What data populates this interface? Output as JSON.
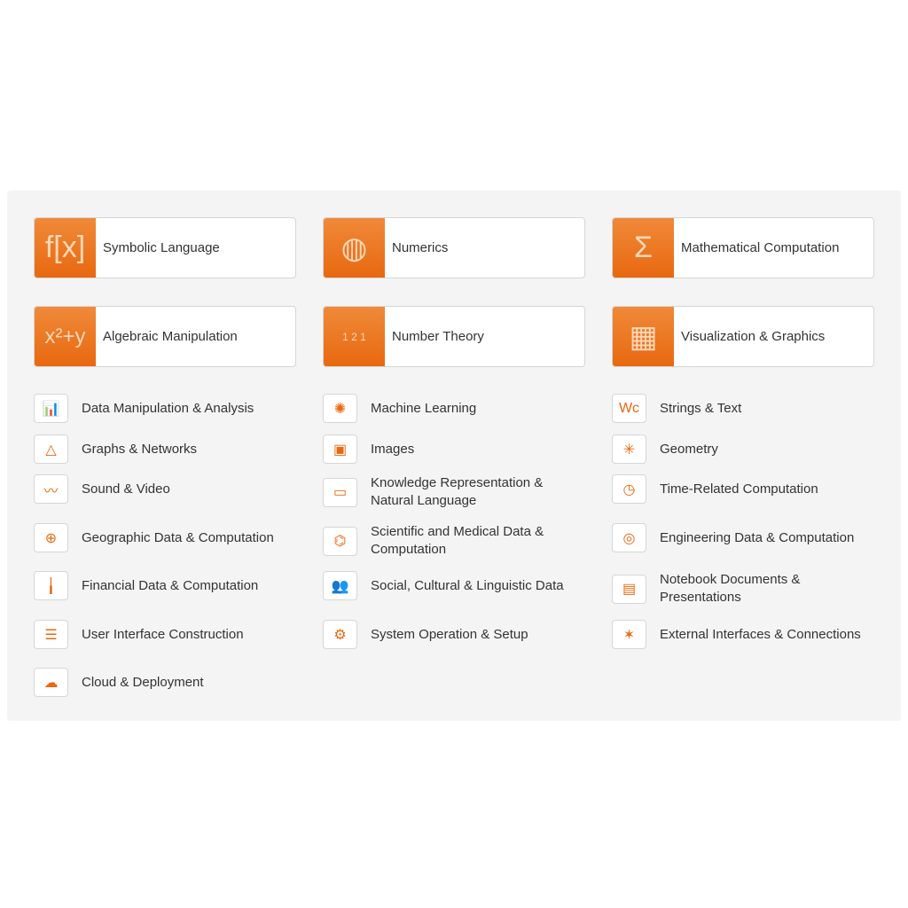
{
  "accent": "#e8680f",
  "featured": [
    {
      "label": "Symbolic Language",
      "icon": "f[x]",
      "icon_name": "fx-icon"
    },
    {
      "label": "Numerics",
      "icon": "◍",
      "icon_name": "sphere-mesh-icon"
    },
    {
      "label": "Mathematical Computation",
      "icon": "Σ",
      "icon_name": "summation-icon"
    },
    {
      "label": "Algebraic Manipulation",
      "icon": "x²+y",
      "icon_name": "algebra-icon"
    },
    {
      "label": "Number Theory",
      "icon": "1 2 1",
      "icon_name": "pascal-triangle-icon"
    },
    {
      "label": "Visualization & Graphics",
      "icon": "▦",
      "icon_name": "3d-plot-icon"
    }
  ],
  "columns": [
    [
      {
        "label": "Data Manipulation & Analysis",
        "icon": "📊",
        "icon_name": "bar-chart-icon"
      },
      {
        "label": "Graphs & Networks",
        "icon": "△",
        "icon_name": "graph-icon"
      },
      {
        "label": "Sound & Video",
        "icon": "〰",
        "icon_name": "waveform-icon"
      },
      {
        "label": "Geographic Data & Computation",
        "icon": "⊕",
        "icon_name": "globe-pin-icon"
      },
      {
        "label": "Financial Data & Computation",
        "icon": "╽",
        "icon_name": "candlestick-icon"
      },
      {
        "label": "User Interface Construction",
        "icon": "☰",
        "icon_name": "sliders-icon"
      },
      {
        "label": "Cloud & Deployment",
        "icon": "☁",
        "icon_name": "cloud-icon"
      }
    ],
    [
      {
        "label": "Machine Learning",
        "icon": "✺",
        "icon_name": "brain-icon"
      },
      {
        "label": "Images",
        "icon": "▣",
        "icon_name": "image-icon"
      },
      {
        "label": "Knowledge Representation & Natural Language",
        "icon": "▭",
        "icon_name": "chat-icon"
      },
      {
        "label": "Scientific and Medical Data & Computation",
        "icon": "⌬",
        "icon_name": "molecule-icon"
      },
      {
        "label": "Social, Cultural & Linguistic Data",
        "icon": "👥",
        "icon_name": "people-icon"
      },
      {
        "label": "System Operation & Setup",
        "icon": "⚙",
        "icon_name": "monitor-gear-icon"
      }
    ],
    [
      {
        "label": "Strings & Text",
        "icon": "Wc",
        "icon_name": "text-icon"
      },
      {
        "label": "Geometry",
        "icon": "✳",
        "icon_name": "polyhedron-icon"
      },
      {
        "label": "Time-Related Computation",
        "icon": "◷",
        "icon_name": "clock-icon"
      },
      {
        "label": "Engineering Data & Computation",
        "icon": "◎",
        "icon_name": "engineering-icon"
      },
      {
        "label": "Notebook Documents & Presentations",
        "icon": "▤",
        "icon_name": "notebook-icon"
      },
      {
        "label": "External Interfaces & Connections",
        "icon": "✶",
        "icon_name": "connections-icon"
      }
    ]
  ]
}
